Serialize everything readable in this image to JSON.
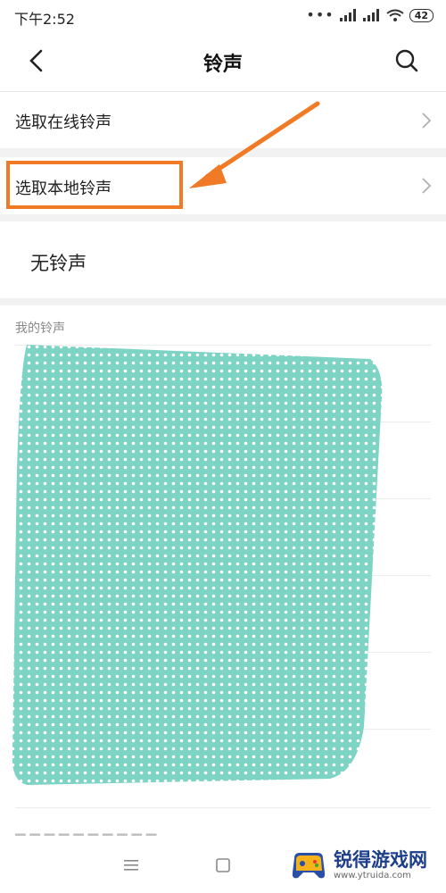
{
  "status_bar": {
    "time": "下午2:52",
    "battery": "42"
  },
  "header": {
    "title": "铃声"
  },
  "rows": {
    "online": "选取在线铃声",
    "local": "选取本地铃声",
    "none": "无铃声"
  },
  "section": {
    "my_ringtones": "我的铃声"
  },
  "watermark": {
    "brand": "锐得游戏网",
    "url": "www.ytruida.com"
  },
  "colors": {
    "highlight": "#f07a25",
    "blur": "#7dd3c4"
  }
}
